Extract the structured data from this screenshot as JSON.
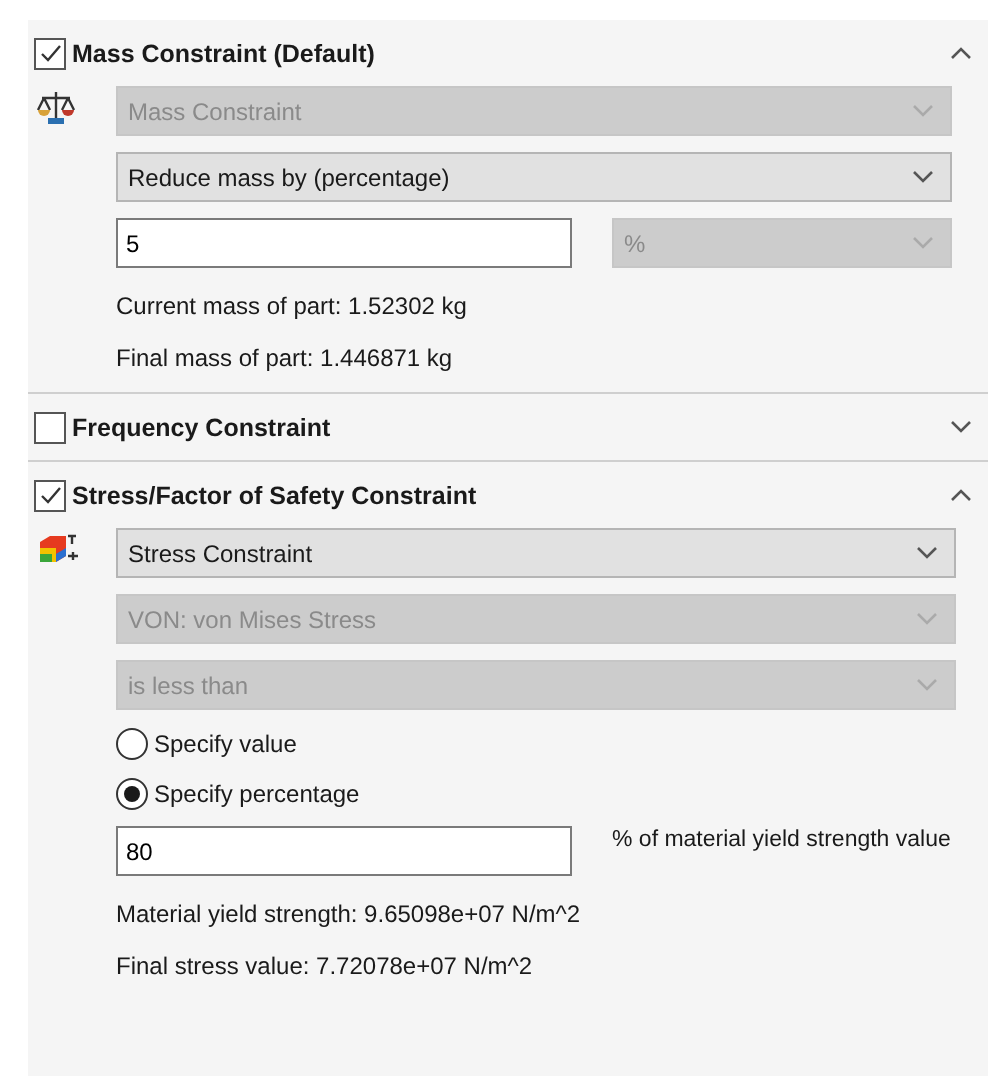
{
  "sections": [
    {
      "title": "Mass Constraint (Default)",
      "checked": true,
      "expanded": true,
      "kind": "mass",
      "items": [
        {
          "kind": "dropdown",
          "value": "Mass Constraint",
          "disabled": true
        },
        {
          "kind": "dropdown",
          "value": "Reduce mass by (percentage)",
          "disabled": false
        },
        {
          "kind": "input-unit",
          "value": "5",
          "unit": "%",
          "unit_disabled": true
        },
        {
          "kind": "text",
          "text": "Current mass of part: 1.52302 kg"
        },
        {
          "kind": "text",
          "text": "Final mass of part: 1.446871 kg"
        }
      ]
    },
    {
      "title": "Frequency Constraint",
      "checked": false,
      "expanded": false
    },
    {
      "title": "Stress/Factor of Safety Constraint",
      "checked": true,
      "expanded": true,
      "kind": "stress",
      "items": [
        {
          "kind": "dropdown",
          "value": "Stress Constraint",
          "disabled": false
        },
        {
          "kind": "dropdown",
          "value": "VON: von Mises Stress",
          "disabled": true
        },
        {
          "kind": "dropdown",
          "value": "is less than",
          "disabled": true
        },
        {
          "kind": "radio",
          "label": "Specify value",
          "selected": false
        },
        {
          "kind": "radio",
          "label": "Specify percentage",
          "selected": true
        },
        {
          "kind": "input-label",
          "value": "80",
          "caption": "% of material yield strength value"
        },
        {
          "kind": "text",
          "text": "Material yield strength: 9.65098e+07 N/m^2"
        },
        {
          "kind": "text",
          "text": "Final stress value: 7.72078e+07 N/m^2"
        }
      ]
    }
  ]
}
